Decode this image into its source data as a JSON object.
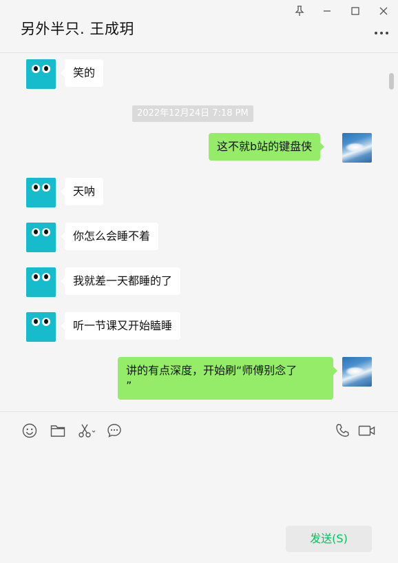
{
  "window": {
    "title": "另外半只. 王成玥"
  },
  "messages": [
    {
      "direction": "in",
      "text": "笑的"
    },
    {
      "direction": "out",
      "text": "这不就b站的键盘侠"
    },
    {
      "direction": "in",
      "text": "天呐"
    },
    {
      "direction": "in",
      "text": "你怎么会睡不着"
    },
    {
      "direction": "in",
      "text": "我就差一天都睡的了"
    },
    {
      "direction": "in",
      "text": "听一节课又开始瞌睡"
    },
    {
      "direction": "out",
      "text": "讲的有点深度，开始刷“师傅别念了\n”"
    }
  ],
  "timestamp": "2022年12月24日 7:18 PM",
  "toolbar": {
    "left_icons": [
      "emoji-icon",
      "folder-icon",
      "scissors-icon",
      "chat-history-icon"
    ],
    "right_icons": [
      "phone-icon",
      "video-icon"
    ]
  },
  "composer": {
    "send_label": "发送(S)"
  },
  "colors": {
    "outgoing_bubble": "#95ec69",
    "incoming_bubble": "#ffffff",
    "robot_avatar": "#16bccb",
    "send_text": "#07c160"
  }
}
